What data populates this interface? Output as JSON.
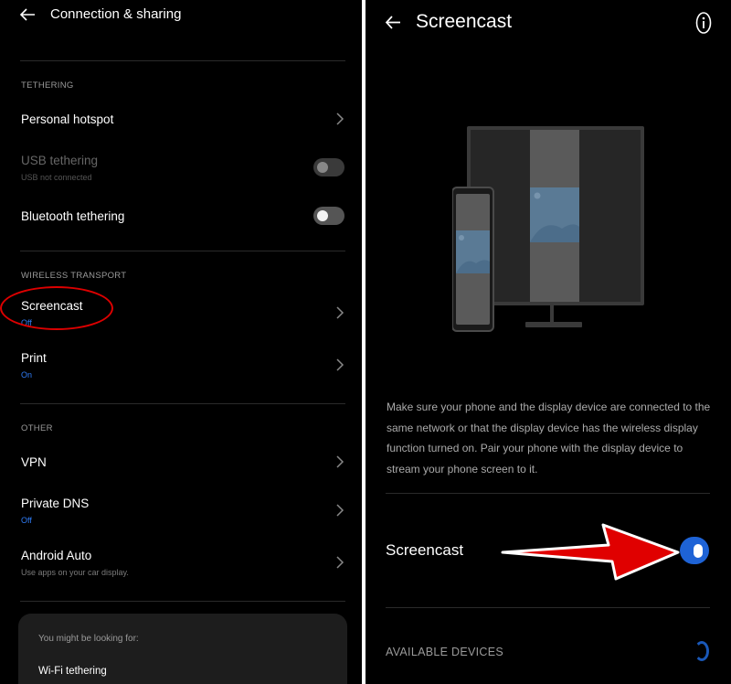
{
  "left": {
    "title": "Connection & sharing",
    "sections": {
      "tethering": "TETHERING",
      "wireless": "WIRELESS TRANSPORT",
      "other": "OTHER"
    },
    "items": {
      "personal_hotspot": {
        "label": "Personal hotspot"
      },
      "usb_tethering": {
        "label": "USB tethering",
        "sub": "USB not connected",
        "toggle": "off-disabled"
      },
      "bluetooth_tethering": {
        "label": "Bluetooth tethering",
        "toggle": "off"
      },
      "screencast": {
        "label": "Screencast",
        "sub": "Off"
      },
      "print": {
        "label": "Print",
        "sub": "On"
      },
      "vpn": {
        "label": "VPN"
      },
      "private_dns": {
        "label": "Private DNS",
        "sub": "Off"
      },
      "android_auto": {
        "label": "Android Auto",
        "sub": "Use apps on your car display."
      }
    },
    "suggestion_card": {
      "hint": "You might be looking for:",
      "link": "Wi-Fi tethering"
    }
  },
  "right": {
    "title": "Screencast",
    "description": "Make sure your phone and the display device are connected to the same network or that the display device has the wireless display function turned on. Pair your phone with the display device to stream your phone screen to it.",
    "screencast_label": "Screencast",
    "screencast_toggle": "on",
    "available_devices": "AVAILABLE DEVICES"
  },
  "colors": {
    "accent": "#2f7cf6",
    "toggle_on": "#1e63d6",
    "annotation": "#e00000"
  },
  "icons": [
    "back-arrow-icon",
    "chevron-right-icon",
    "info-icon",
    "loading-spinner-icon",
    "tv-phone-illustration"
  ]
}
